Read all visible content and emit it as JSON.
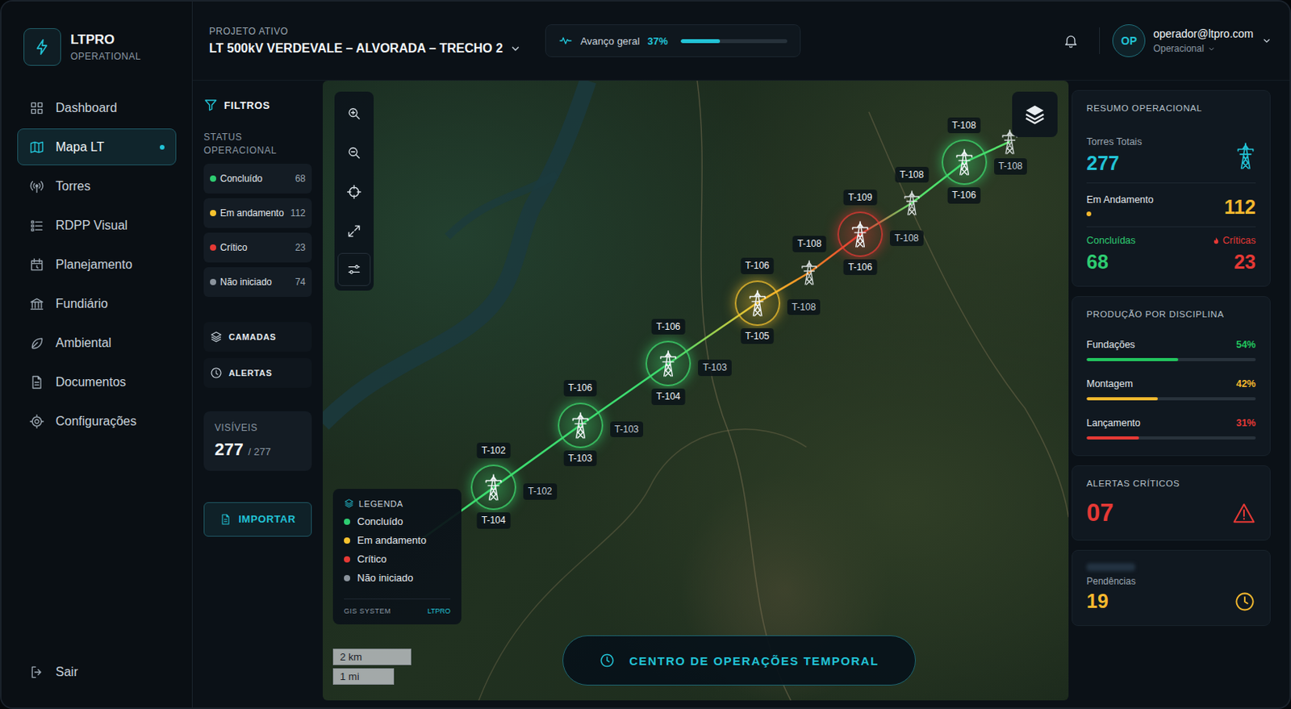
{
  "sidebar": {
    "logo": {
      "title": "LTPRO",
      "subtitle": "OPERATIONAL"
    },
    "items": [
      {
        "label": "Dashboard",
        "selected": false
      },
      {
        "label": "Mapa LT",
        "selected": true
      },
      {
        "label": "Torres",
        "selected": false
      },
      {
        "label": "RDPP Visual",
        "selected": false
      },
      {
        "label": "Planejamento",
        "selected": false
      },
      {
        "label": "Fundiário",
        "selected": false
      },
      {
        "label": "Ambiental",
        "selected": false
      },
      {
        "label": "Documentos",
        "selected": false
      },
      {
        "label": "Configurações",
        "selected": false
      }
    ],
    "logout": "Sair"
  },
  "header": {
    "project_label": "PROJETO ATIVO",
    "project": "LT 500kV VERDEVALE – ALVORADA – TRECHO 2",
    "progress": {
      "label": "Avanço geral",
      "reading": "37%",
      "level": 0.37
    },
    "user": {
      "initials": "OP",
      "email": "operador@ltpro.com",
      "role": "Operacional"
    }
  },
  "filters": {
    "title": "FILTROS",
    "status_title": "STATUS OPERACIONAL",
    "statuses": [
      {
        "label": "Concluído",
        "count": "68",
        "color": "#2ecc71"
      },
      {
        "label": "Em andamento",
        "count": "112",
        "color": "#f5c22e"
      },
      {
        "label": "Crítico",
        "count": "23",
        "color": "#e53935"
      },
      {
        "label": "Não iniciado",
        "count": "74",
        "color": "#8a939c"
      }
    ],
    "buttons": [
      "CAMADAS",
      "ALERTAS"
    ],
    "visible": {
      "label": "VISÍVEIS",
      "value": "277",
      "total": "/ 277"
    },
    "import": "IMPORTAR"
  },
  "map": {
    "towers": [
      {
        "top": "T-102",
        "bottom": "T-104",
        "side": "T-102",
        "color": "#3ddc6f",
        "ring": true
      },
      {
        "top": "T-106",
        "bottom": "T-103",
        "side": "T-103",
        "color": "#3ddc6f",
        "ring": true
      },
      {
        "top": "T-106",
        "bottom": "T-104",
        "side": "T-103",
        "color": "#3ddc6f",
        "ring": true
      },
      {
        "top": "T-106",
        "bottom": "T-105",
        "side": "T-108",
        "color": "#f5c22e",
        "ring": true
      },
      {
        "top": "T-108",
        "color": "#f08a24",
        "ring": false
      },
      {
        "top": "T-109",
        "bottom": "T-106",
        "side": "T-108",
        "color": "#e53935",
        "ring": true
      },
      {
        "top": "T-108",
        "color": "#5ee36a",
        "ring": false
      },
      {
        "top": "T-108",
        "bottom": "T-106",
        "side": "T-108",
        "color": "#3ddc6f",
        "ring": true
      },
      {
        "color": "#5ee36a",
        "ring": false
      }
    ],
    "legend": {
      "title": "LEGENDA",
      "items": [
        {
          "label": "Concluído",
          "color": "#2ecc71"
        },
        {
          "label": "Em andamento",
          "color": "#f5c22e"
        },
        {
          "label": "Crítico",
          "color": "#e53935"
        },
        {
          "label": "Não iniciado",
          "color": "#8a939c"
        }
      ],
      "footer_left": "GIS SYSTEM",
      "footer_right": "LTPRO"
    },
    "scale": [
      "2 km",
      "1 mi"
    ],
    "timeline_button": "CENTRO DE OPERAÇÕES TEMPORAL"
  },
  "summary": {
    "title": "RESUMO OPERACIONAL",
    "total": {
      "label": "Torres Totais",
      "value": "277"
    },
    "in_progress": {
      "label": "Em Andamento",
      "value": "112"
    },
    "done": {
      "label": "Concluídas",
      "value": "68"
    },
    "critical": {
      "label": "Críticas",
      "value": "23"
    }
  },
  "production": {
    "title": "PRODUÇÃO POR DISCIPLINA",
    "items": [
      {
        "label": "Fundações",
        "reading": "54%",
        "level": 0.54,
        "color": "#22c55e"
      },
      {
        "label": "Montagem",
        "reading": "42%",
        "level": 0.42,
        "color": "#f5b82e"
      },
      {
        "label": "Lançamento",
        "reading": "31%",
        "level": 0.31,
        "color": "#e53935"
      }
    ]
  },
  "alerts": {
    "title": "ALERTAS CRÍTICOS",
    "value": "07"
  },
  "pending": {
    "label": "Pendências",
    "value": "19"
  }
}
